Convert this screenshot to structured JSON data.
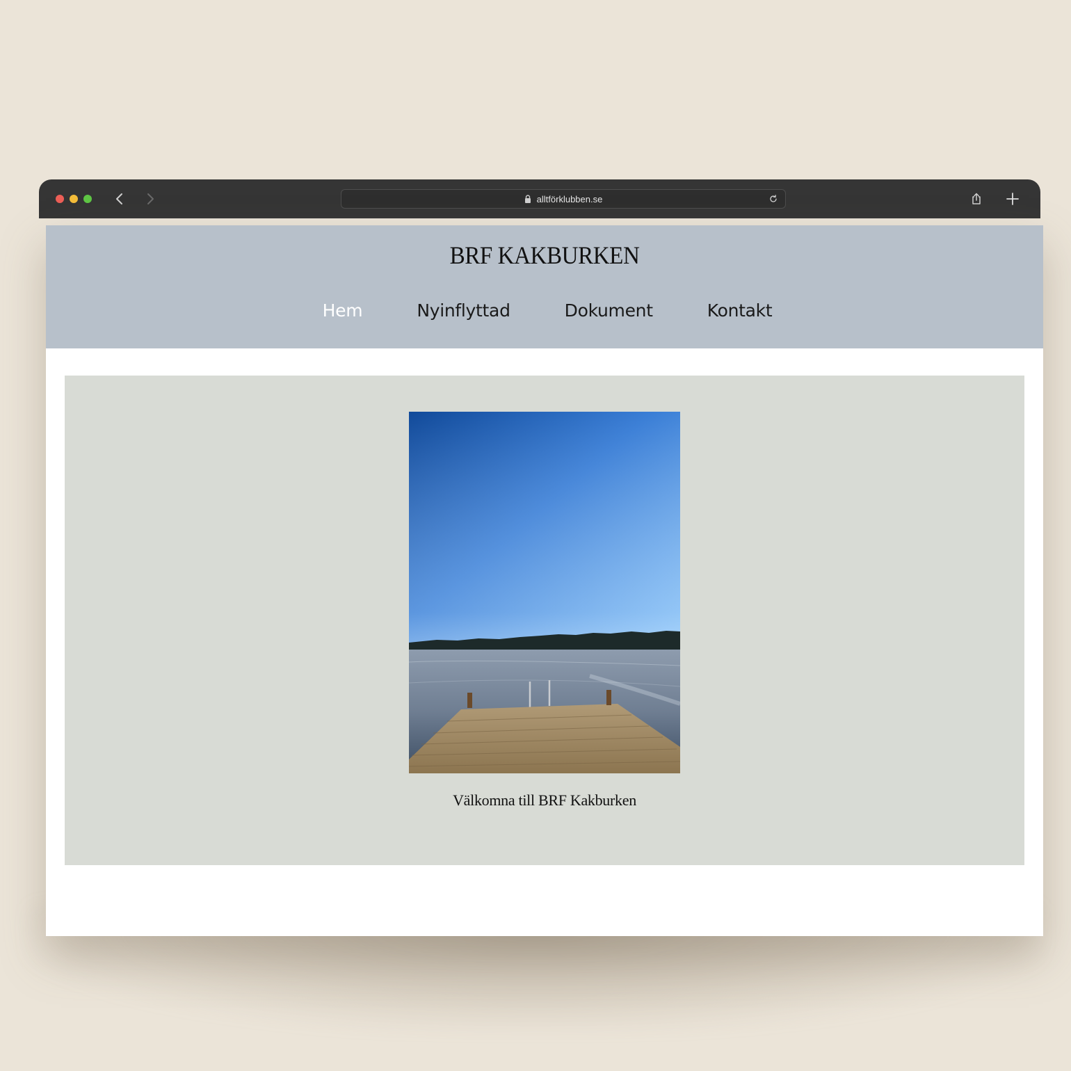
{
  "browser": {
    "url": "alltförklubben.se"
  },
  "site": {
    "title": "BRF KAKBURKEN",
    "nav": [
      {
        "label": "Hem",
        "active": true
      },
      {
        "label": "Nyinflyttad",
        "active": false
      },
      {
        "label": "Dokument",
        "active": false
      },
      {
        "label": "Kontakt",
        "active": false
      }
    ]
  },
  "hero": {
    "caption": "Välkomna till BRF Kakburken"
  },
  "colors": {
    "page_background": "#ebe4d8",
    "browser_chrome": "#353535",
    "header_background": "#b7c0ca",
    "hero_background": "#d8dbd5",
    "nav_active": "#ffffff"
  }
}
